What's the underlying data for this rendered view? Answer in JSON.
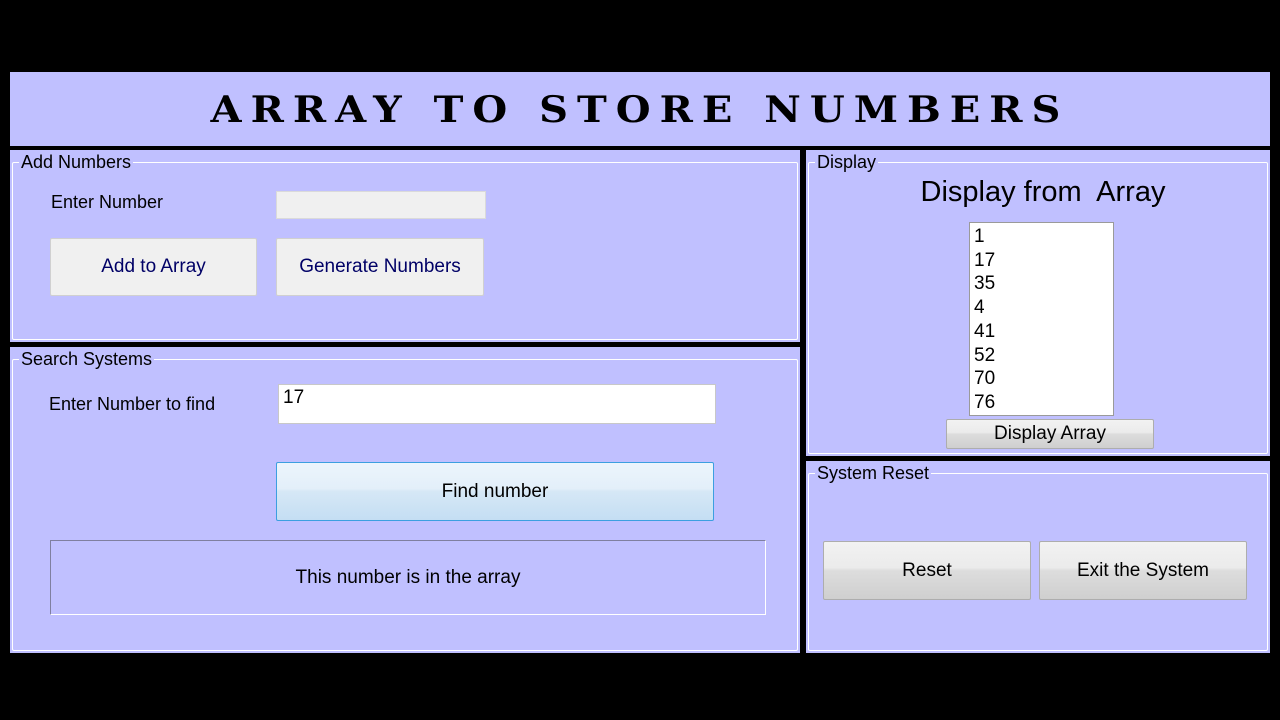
{
  "header": {
    "title": "Array to Store Numbers"
  },
  "add_numbers": {
    "legend": "Add Numbers",
    "enter_label": "Enter Number",
    "number_value": "",
    "add_button": "Add to Array",
    "generate_button": "Generate Numbers"
  },
  "search": {
    "legend": "Search Systems",
    "find_label": "Enter Number to find",
    "find_value": "17",
    "find_button": "Find number",
    "result_text": "This number is in the array"
  },
  "display": {
    "legend": "Display",
    "heading": "Display from  Array",
    "items": [
      "1",
      "17",
      "35",
      "4",
      "41",
      "52",
      "70",
      "76"
    ],
    "display_button": "Display Array"
  },
  "reset": {
    "legend": "System Reset",
    "reset_button": "Reset",
    "exit_button": "Exit the System"
  }
}
